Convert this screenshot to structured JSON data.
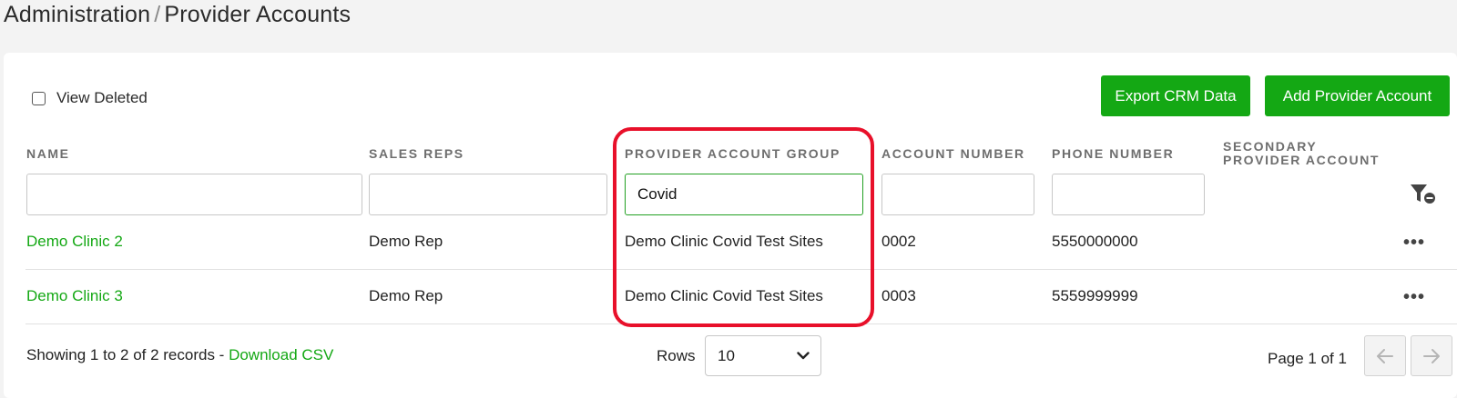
{
  "breadcrumb": {
    "parent": "Administration",
    "separator": "/",
    "current": "Provider Accounts"
  },
  "toolbar": {
    "view_deleted_label": "View Deleted",
    "export_label": "Export CRM Data",
    "add_label": "Add Provider Account"
  },
  "columns": {
    "name": "NAME",
    "sales_reps": "SALES REPS",
    "group": "PROVIDER ACCOUNT GROUP",
    "account_number": "ACCOUNT NUMBER",
    "phone_number": "PHONE NUMBER",
    "secondary_line1": "SECONDARY",
    "secondary_line2": "PROVIDER ACCOUNT"
  },
  "filters": {
    "name": "",
    "sales_reps": "",
    "group": "Covid",
    "account_number": "",
    "phone_number": ""
  },
  "rows": [
    {
      "name": "Demo Clinic 2",
      "sales_rep": "Demo Rep",
      "group": "Demo Clinic Covid Test Sites",
      "account_number": "0002",
      "phone": "5550000000",
      "actions": "•••"
    },
    {
      "name": "Demo Clinic 3",
      "sales_rep": "Demo Rep",
      "group": "Demo Clinic Covid Test Sites",
      "account_number": "0003",
      "phone": "5559999999",
      "actions": "•••"
    }
  ],
  "footer": {
    "showing": "Showing 1 to 2 of 2 records - ",
    "download": "Download CSV",
    "rows_label": "Rows",
    "rows_value": "10",
    "page_label": "Page 1 of 1"
  },
  "icons": {
    "filter_clear": "filter-remove-icon",
    "prev": "arrow-left-icon",
    "next": "arrow-right-icon",
    "dropdown": "chevron-down-icon"
  },
  "colors": {
    "accent": "#14a814",
    "highlight": "#e8102a"
  }
}
